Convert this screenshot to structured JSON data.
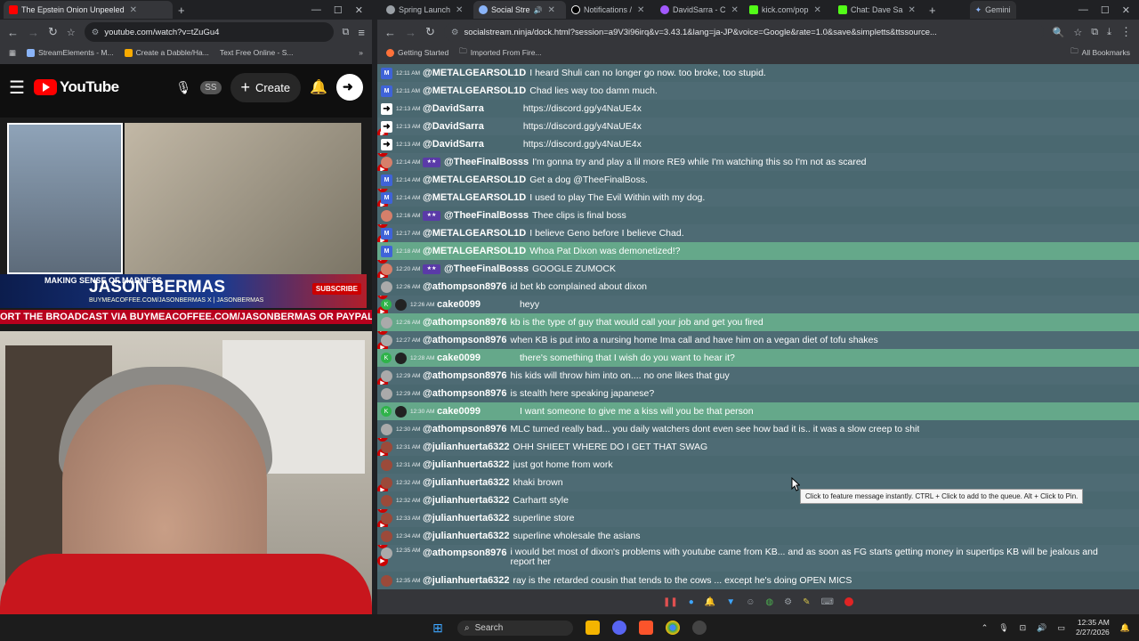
{
  "left_browser": {
    "tabs": [
      {
        "label": "The Epstein Onion Unpeeled",
        "color": "#ff0000"
      }
    ],
    "url": "youtube.com/watch?v=tZuGu4",
    "bookmarks": [
      "StreamElements - M...",
      "Create a Dabble/Ha...",
      "Text Free Online - S..."
    ]
  },
  "youtube": {
    "logo_text": "YouTube",
    "ss_badge": "SS",
    "create_label": "Create",
    "video": {
      "show_title": "MAKING SENSE OF MADNESS",
      "host_name": "JASON BERMAS",
      "host_sub": "BUYMEACOFFEE.COM/JASONBERMAS   X | JASONBERMAS",
      "ticker": "ORT THE BROADCAST VIA BUYMEACOFFEE.COM/JASONBERMAS OR PAYPAL VIA JASON",
      "watermark": "SUBSCRIBE"
    }
  },
  "right_browser": {
    "tabs": [
      {
        "label": "Spring Launch",
        "color": "#9aa0a6"
      },
      {
        "label": "Social Stre",
        "color": "#8ab4f8",
        "active": true
      },
      {
        "label": "Notifications /",
        "color": "#ffffff"
      },
      {
        "label": "DavidSarra - C",
        "color": "#a259ff"
      },
      {
        "label": "kick.com/pop",
        "color": "#53fc18"
      },
      {
        "label": "Chat: Dave Sa",
        "color": "#53fc18"
      },
      {
        "label": "Gemini",
        "color": "#8ab4f8"
      }
    ],
    "url": "socialstream.ninja/dock.html?session=a9V3i96irq&v=3.43.1&lang=ja-JP&voice=Google&rate=1.0&save&simpletts&ttssource...",
    "bookmarks": [
      "Getting Started",
      "Imported From Fire...",
      "All Bookmarks"
    ]
  },
  "chat": {
    "messages": [
      {
        "src": "yt",
        "av": "m",
        "time": "12:11 AM",
        "user": "@METALGEARSOL1D",
        "text": "I heard Shuli can no longer go now. too broke, too stupid."
      },
      {
        "src": "yt",
        "av": "m",
        "time": "12:11 AM",
        "user": "@METALGEARSOL1D",
        "text": "Chad lies way too damn much."
      },
      {
        "src": "yt",
        "av": "x",
        "time": "12:13 AM",
        "user": "@DavidSarra",
        "text": "https://discord.gg/y4NaUE4x",
        "gap": true
      },
      {
        "src": "yt",
        "av": "x",
        "time": "12:13 AM",
        "user": "@DavidSarra",
        "text": "https://discord.gg/y4NaUE4x",
        "gap": true
      },
      {
        "src": "yt",
        "av": "x",
        "time": "12:13 AM",
        "user": "@DavidSarra",
        "text": "https://discord.gg/y4NaUE4x",
        "gap": true
      },
      {
        "src": "yt",
        "av": "r",
        "time": "12:14 AM",
        "badge": true,
        "user": "@TheeFinalBosss",
        "text": "I'm gonna try and play a lil more RE9 while I'm watching this so I'm not as scared"
      },
      {
        "src": "yt",
        "av": "m",
        "time": "12:14 AM",
        "user": "@METALGEARSOL1D",
        "text": "Get a dog @TheeFinalBoss."
      },
      {
        "src": "yt",
        "av": "m",
        "time": "12:14 AM",
        "user": "@METALGEARSOL1D",
        "text": "I used to play The Evil Within with my dog."
      },
      {
        "src": "yt",
        "av": "r",
        "time": "12:16 AM",
        "badge": true,
        "user": "@TheeFinalBosss",
        "text": "Thee clips is final boss"
      },
      {
        "src": "yt",
        "av": "m",
        "time": "12:17 AM",
        "user": "@METALGEARSOL1D",
        "text": "I believe Geno before I believe Chad."
      },
      {
        "src": "yt",
        "av": "m",
        "time": "12:18 AM",
        "user": "@METALGEARSOL1D",
        "text": "Whoa Pat Dixon was demonetized!?",
        "hl": true
      },
      {
        "src": "yt",
        "av": "r",
        "time": "12:20 AM",
        "badge": true,
        "user": "@TheeFinalBosss",
        "text": "GOOGLE ZUMOCK"
      },
      {
        "src": "yt",
        "av": "g",
        "time": "12:26 AM",
        "user": "@athompson8976",
        "text": "id bet kb complained about dixon"
      },
      {
        "src": "kick",
        "av": "k",
        "time": "12:26 AM",
        "user": "cake0099",
        "text": "heyy",
        "gap": true
      },
      {
        "src": "yt",
        "av": "g",
        "time": "12:26 AM",
        "user": "@athompson8976",
        "text": "kb is the type of guy that would call your job and get you fired",
        "hl": true
      },
      {
        "src": "yt",
        "av": "g",
        "time": "12:27 AM",
        "user": "@athompson8976",
        "text": "when KB is put into a nursing home Ima call and have him on a vegan diet of tofu shakes"
      },
      {
        "src": "kick",
        "av": "k",
        "time": "12:28 AM",
        "user": "cake0099",
        "text": "there's something that I wish do you want to hear it?",
        "gap": true,
        "hl": true
      },
      {
        "src": "yt",
        "av": "g",
        "time": "12:29 AM",
        "user": "@athompson8976",
        "text": "his kids will throw him into on.... no one likes that guy"
      },
      {
        "src": "yt",
        "av": "g",
        "time": "12:29 AM",
        "user": "@athompson8976",
        "text": "is stealth here speaking japanese?"
      },
      {
        "src": "kick",
        "av": "k",
        "time": "12:30 AM",
        "user": "cake0099",
        "text": "I want someone to give me a kiss will you be that person",
        "gap": true,
        "hl": true
      },
      {
        "src": "yt",
        "av": "g",
        "time": "12:30 AM",
        "user": "@athompson8976",
        "text": "MLC turned really bad... you daily watchers dont even see how bad it is.. it was a slow creep to shit"
      },
      {
        "src": "yt",
        "av": "j",
        "time": "12:31 AM",
        "user": "@julianhuerta6322",
        "text": "OHH SHIEET WHERE DO I GET THAT SWAG"
      },
      {
        "src": "yt",
        "av": "j",
        "time": "12:31 AM",
        "user": "@julianhuerta6322",
        "text": "just got home from work"
      },
      {
        "src": "yt",
        "av": "j",
        "time": "12:32 AM",
        "user": "@julianhuerta6322",
        "text": "khaki brown"
      },
      {
        "src": "yt",
        "av": "j",
        "time": "12:32 AM",
        "user": "@julianhuerta6322",
        "text": "Carhartt style"
      },
      {
        "src": "yt",
        "av": "j",
        "time": "12:33 AM",
        "user": "@julianhuerta6322",
        "text": "superline store"
      },
      {
        "src": "yt",
        "av": "j",
        "time": "12:34 AM",
        "user": "@julianhuerta6322",
        "text": "superline wholesale the asians"
      },
      {
        "src": "yt",
        "av": "g",
        "time": "12:35 AM",
        "user": "@athompson8976",
        "text": "i would bet most of dixon's problems with youtube came from KB... and as soon as FG starts getting money in supertips KB will be jealous and report her",
        "tall": true
      },
      {
        "src": "yt",
        "av": "j",
        "time": "12:35 AM",
        "user": "@julianhuerta6322",
        "text": "ray is the retarded cousin that tends to the cows ... except he's doing OPEN MICS"
      }
    ],
    "tooltip": "Click to feature message instantly. CTRL + Click to add to the queue. Alt + Click to Pin."
  },
  "taskbar": {
    "search_label": "Search",
    "time": "12:35 AM",
    "date": "2/27/2026"
  },
  "colors": {
    "chat_bg": "#4e6b74",
    "highlight_row": "#65a88a",
    "youtube_red": "#ff0000",
    "kick_green": "#2fb34a"
  }
}
